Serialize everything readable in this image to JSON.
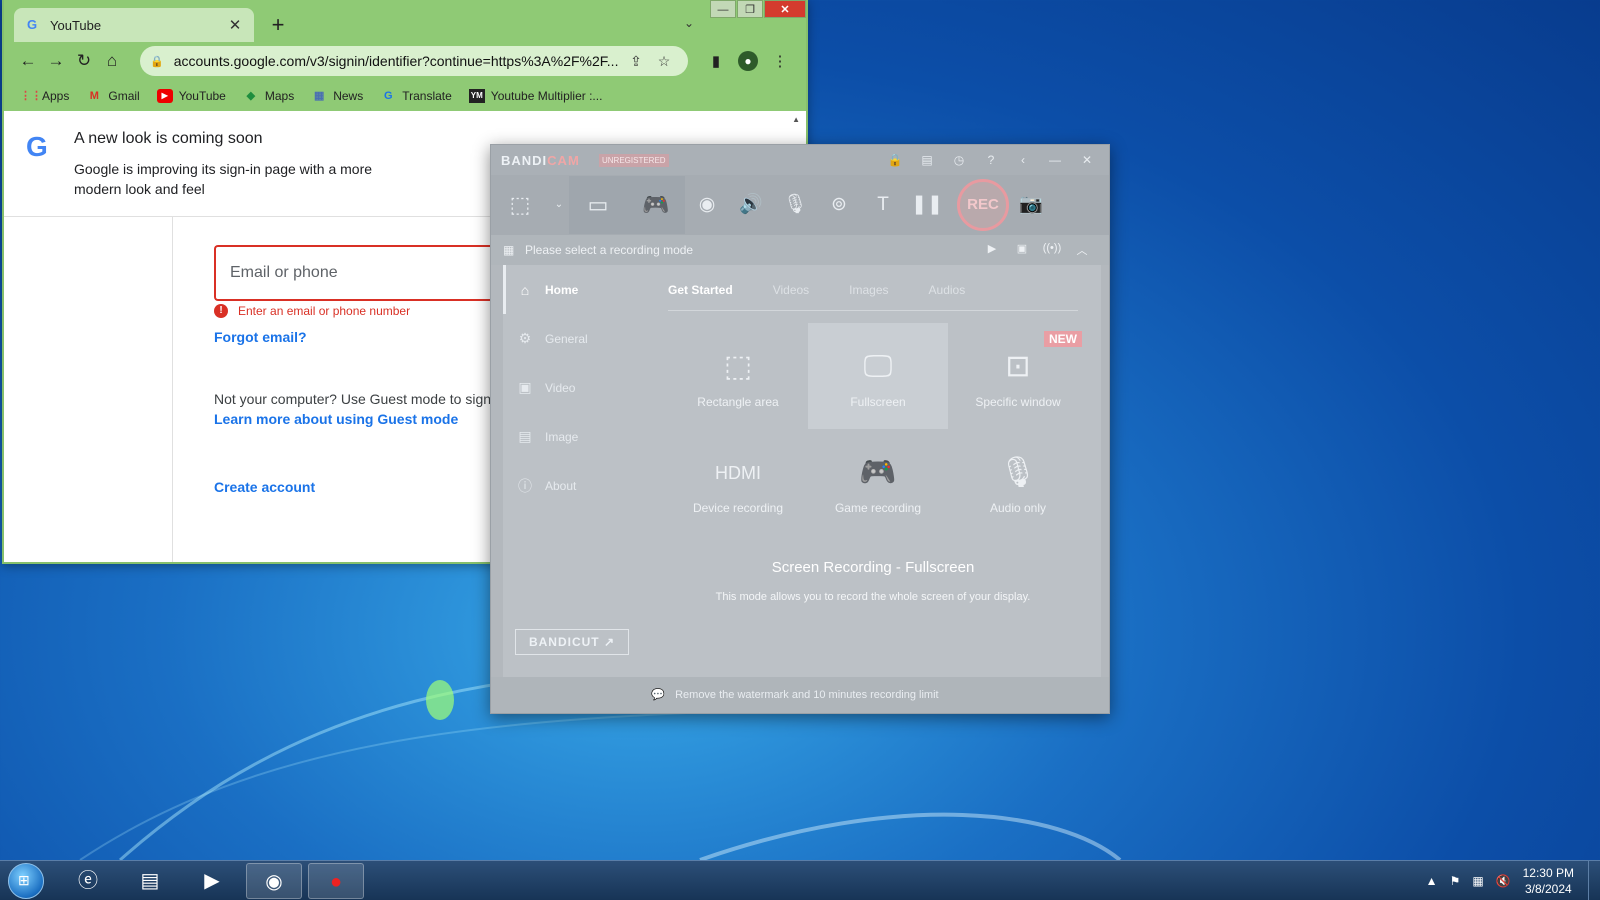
{
  "chrome": {
    "tab_title": "YouTube",
    "new_tab": "+",
    "url": "accounts.google.com/v3/signin/identifier?continue=https%3A%2F%2F...",
    "bookmarks": [
      {
        "label": "Apps",
        "icon": "apps-grid-icon"
      },
      {
        "label": "Gmail",
        "icon": "gmail-icon"
      },
      {
        "label": "YouTube",
        "icon": "youtube-icon"
      },
      {
        "label": "Maps",
        "icon": "maps-icon"
      },
      {
        "label": "News",
        "icon": "news-icon"
      },
      {
        "label": "Translate",
        "icon": "translate-icon"
      },
      {
        "label": "Youtube Multiplier :...",
        "icon": "ytm-icon"
      }
    ]
  },
  "signin": {
    "notice_title": "A new look is coming soon",
    "notice_text": "Google is improving its sign-in page with a more modern look and feel",
    "email_placeholder": "Email or phone",
    "error_text": "Enter an email or phone number",
    "forgot_email": "Forgot email?",
    "guest_text": "Not your computer? Use Guest mode to sign",
    "guest_link": "Learn more about using Guest mode",
    "create_account": "Create account"
  },
  "bandicam": {
    "logo_main": "BANDI",
    "logo_accent": "CAM",
    "unregistered": "UNREGISTERED",
    "rec_label": "REC",
    "mode_prompt": "Please select a recording mode",
    "sidebar": [
      {
        "label": "Home",
        "icon": "home-icon"
      },
      {
        "label": "General",
        "icon": "gear-icon"
      },
      {
        "label": "Video",
        "icon": "video-icon"
      },
      {
        "label": "Image",
        "icon": "image-icon"
      },
      {
        "label": "About",
        "icon": "info-icon"
      }
    ],
    "bandicut": "BANDICUT ↗",
    "tabs": [
      "Get Started",
      "Videos",
      "Images",
      "Audios"
    ],
    "tiles": [
      {
        "label": "Rectangle area",
        "icon": "rectangle-area-icon"
      },
      {
        "label": "Fullscreen",
        "icon": "monitor-icon"
      },
      {
        "label": "Specific window",
        "icon": "window-lock-icon",
        "badge": "NEW"
      },
      {
        "label": "Device recording",
        "icon": "hdmi-icon"
      },
      {
        "label": "Game recording",
        "icon": "gamepad-icon"
      },
      {
        "label": "Audio only",
        "icon": "microphone-icon"
      }
    ],
    "desc_title": "Screen Recording - Fullscreen",
    "desc_text": "This mode allows you to record the whole screen of your display.",
    "footer": "Remove the watermark and 10 minutes recording limit",
    "accent_color": "#e99ea4"
  },
  "taskbar": {
    "apps": [
      "internet-explorer-icon",
      "file-explorer-icon",
      "media-player-icon",
      "chrome-icon",
      "bandicam-icon"
    ],
    "time": "12:30 PM",
    "date": "3/8/2024"
  }
}
